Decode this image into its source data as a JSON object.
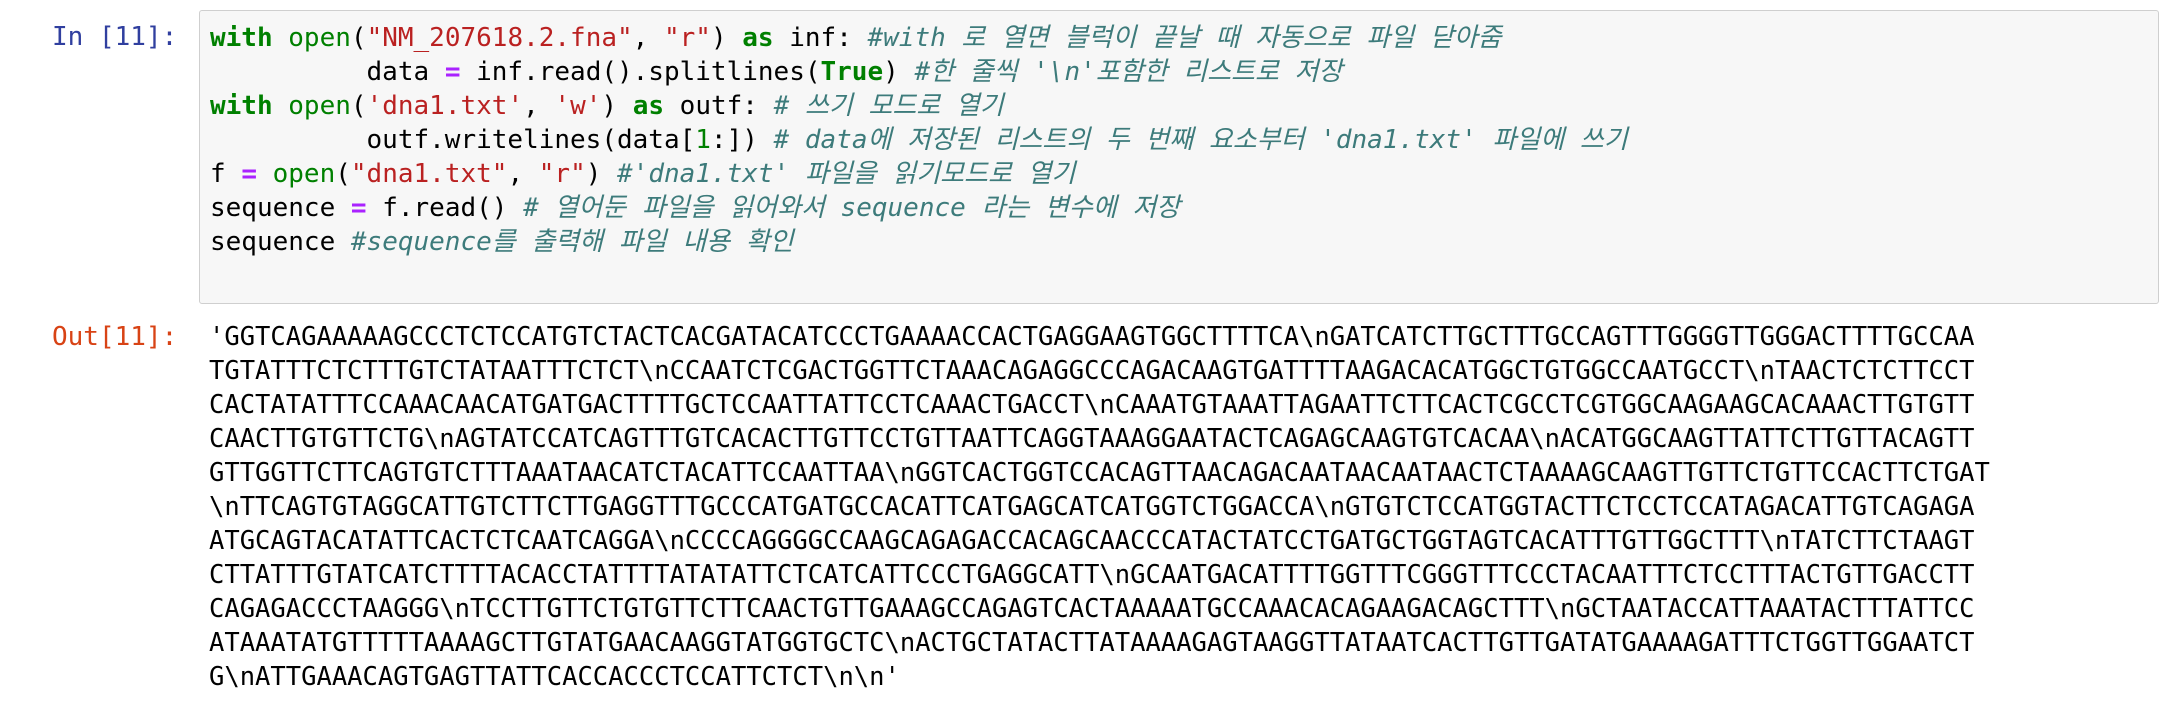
{
  "input_cell": {
    "prompt": "In [11]:",
    "lines": [
      [
        {
          "t": "with",
          "c": "kw"
        },
        {
          "t": " ",
          "c": ""
        },
        {
          "t": "open",
          "c": "fn"
        },
        {
          "t": "(",
          "c": ""
        },
        {
          "t": "\"NM_207618.2.fna\"",
          "c": "str"
        },
        {
          "t": ", ",
          "c": ""
        },
        {
          "t": "\"r\"",
          "c": "str"
        },
        {
          "t": ") ",
          "c": ""
        },
        {
          "t": "as",
          "c": "kw"
        },
        {
          "t": " inf: ",
          "c": ""
        },
        {
          "t": "#with 로 열면 블럭이 끝날 때 자동으로 파일 닫아줌",
          "c": "cm"
        }
      ],
      [
        {
          "t": "          data ",
          "c": ""
        },
        {
          "t": "=",
          "c": "op"
        },
        {
          "t": " inf.read().splitlines(",
          "c": ""
        },
        {
          "t": "True",
          "c": "kw"
        },
        {
          "t": ") ",
          "c": ""
        },
        {
          "t": "#한 줄씩 '\\n'포함한 리스트로 저장",
          "c": "cm"
        }
      ],
      [
        {
          "t": "with",
          "c": "kw"
        },
        {
          "t": " ",
          "c": ""
        },
        {
          "t": "open",
          "c": "fn"
        },
        {
          "t": "(",
          "c": ""
        },
        {
          "t": "'dna1.txt'",
          "c": "str"
        },
        {
          "t": ", ",
          "c": ""
        },
        {
          "t": "'w'",
          "c": "str"
        },
        {
          "t": ") ",
          "c": ""
        },
        {
          "t": "as",
          "c": "kw"
        },
        {
          "t": " outf: ",
          "c": ""
        },
        {
          "t": "# 쓰기 모드로 열기",
          "c": "cm"
        }
      ],
      [
        {
          "t": "          outf.writelines(data[",
          "c": ""
        },
        {
          "t": "1",
          "c": "num"
        },
        {
          "t": ":]) ",
          "c": ""
        },
        {
          "t": "# data에 저장된 리스트의 두 번째 요소부터 'dna1.txt' 파일에 쓰기",
          "c": "cm"
        }
      ],
      [
        {
          "t": "f ",
          "c": ""
        },
        {
          "t": "=",
          "c": "op"
        },
        {
          "t": " ",
          "c": ""
        },
        {
          "t": "open",
          "c": "fn"
        },
        {
          "t": "(",
          "c": ""
        },
        {
          "t": "\"dna1.txt\"",
          "c": "str"
        },
        {
          "t": ", ",
          "c": ""
        },
        {
          "t": "\"r\"",
          "c": "str"
        },
        {
          "t": ") ",
          "c": ""
        },
        {
          "t": "#'dna1.txt' 파일을 읽기모드로 열기",
          "c": "cm"
        }
      ],
      [
        {
          "t": "sequence ",
          "c": ""
        },
        {
          "t": "=",
          "c": "op"
        },
        {
          "t": " f.read() ",
          "c": ""
        },
        {
          "t": "# 열어둔 파일을 읽어와서 sequence 라는 변수에 저장",
          "c": "cm"
        }
      ],
      [
        {
          "t": "sequence ",
          "c": ""
        },
        {
          "t": "#sequence를 출력해 파일 내용 확인",
          "c": "cm"
        }
      ]
    ]
  },
  "output_cell": {
    "prompt": "Out[11]:",
    "lines": [
      "'GGTCAGAAAAAGCCCTCTCCATGTCTACTCACGATACATCCCTGAAAACCACTGAGGAAGTGGCTTTTCA\\nGATCATCTTGCTTTGCCAGTTTGGGGTTGGGACTTTTGCCAA",
      "TGTATTTCTCTTTGTCTATAATTTCTCT\\nCCAATCTCGACTGGTTCTAAACAGAGGCCCAGACAAGTGATTTTAAGACACATGGCTGTGGCCAATGCCT\\nTAACTCTCTTCCT",
      "CACTATATTTCCAAACAACATGATGACTTTTGCTCCAATTATTCCTCAAACTGACCT\\nCAAATGTAAATTAGAATTCTTCACTCGCCTCGTGGCAAGAAGCACAAACTTGTGTT",
      "CAACTTGTGTTCTG\\nAGTATCCATCAGTTTGTCACACTTGTTCCTGTTAATTCAGGTAAAGGAATACTCAGAGCAAGTGTCACAA\\nACATGGCAAGTTATTCTTGTTACAGTT",
      "GTTGGTTCTTCAGTGTCTTTAAATAACATCTACATTCCAATTAA\\nGGTCACTGGTCCACAGTTAACAGACAATAACAATAACTCTAAAAGCAAGTTGTTCTGTTCCACTTCTGAT",
      "\\nTTCAGTGTAGGCATTGTCTTCTTGAGGTTTGCCCATGATGCCACATTCATGAGCATCATGGTCTGGACCA\\nGTGTCTCCATGGTACTTCTCCTCCATAGACATTGTCAGAGA",
      "ATGCAGTACATATTCACTCTCAATCAGGA\\nCCCCAGGGGCCAAGCAGAGACCACAGCAACCCATACTATCCTGATGCTGGTAGTCACATTTGTTGGCTTT\\nTATCTTCTAAGT",
      "CTTATTTGTATCATCTTTTACACCTATTTTATATATTCTCATCATTCCCTGAGGCATT\\nGCAATGACATTTTGGTTTCGGGTTTCCCTACAATTTCTCCTTTACTGTTGACCTT",
      "CAGAGACCCTAAGGG\\nTCCTTGTTCTGTGTTCTTCAACTGTTGAAAGCCAGAGTCACTAAAAATGCCAAACACAGAAGACAGCTTT\\nGCTAATACCATTAAATACTTTATTCC",
      "ATAAATATGTTTTTAAAAGCTTGTATGAACAAGGTATGGTGCTC\\nACTGCTATACTTATAAAAGAGTAAGGTTATAATCACTTGTTGATATGAAAAGATTTCTGGTTGGAATCT",
      "G\\nATTGAAACAGTGAGTTATTCACCACCCTCCATTCTCT\\n\\n'"
    ]
  }
}
